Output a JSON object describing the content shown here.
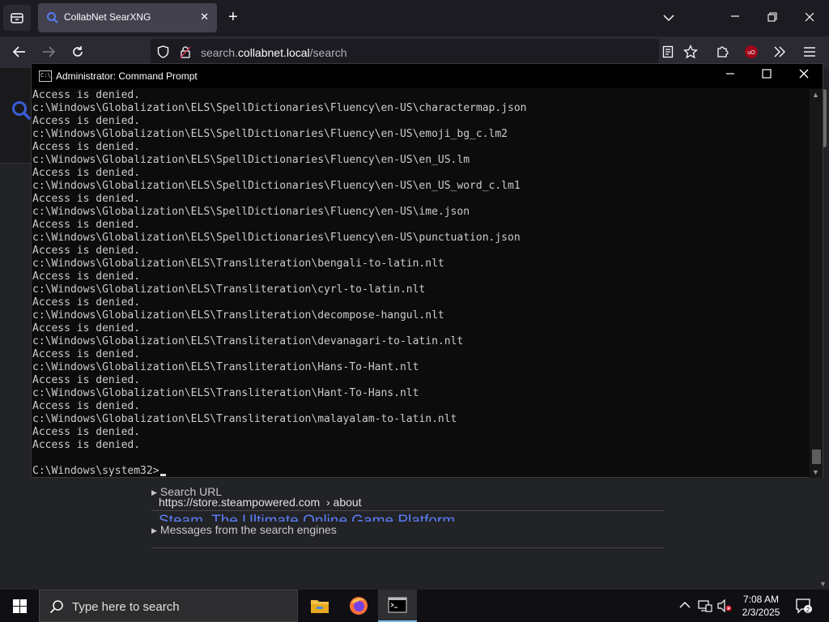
{
  "browser": {
    "tab_title": "CollabNet SearXNG",
    "tab_close_glyph": "✕",
    "new_tab_glyph": "+",
    "url_prefix": "search.",
    "url_domain": "collabnet.local",
    "url_path": "/search",
    "accent_color": "#5b7cf4"
  },
  "page": {
    "details": [
      {
        "label": "Search URL"
      },
      {
        "label": "Messages from the search engines"
      }
    ],
    "result_url": "https://store.steampowered.com",
    "result_breadcrumb": "› about",
    "result_title": "Steam, The Ultimate Online Game Platform"
  },
  "cmd": {
    "title": "Administrator: Command Prompt",
    "icon_text": "C:\\_",
    "lines": [
      "Access is denied.",
      "c:\\Windows\\Globalization\\ELS\\SpellDictionaries\\Fluency\\en-US\\charactermap.json",
      "Access is denied.",
      "c:\\Windows\\Globalization\\ELS\\SpellDictionaries\\Fluency\\en-US\\emoji_bg_c.lm2",
      "Access is denied.",
      "c:\\Windows\\Globalization\\ELS\\SpellDictionaries\\Fluency\\en-US\\en_US.lm",
      "Access is denied.",
      "c:\\Windows\\Globalization\\ELS\\SpellDictionaries\\Fluency\\en-US\\en_US_word_c.lm1",
      "Access is denied.",
      "c:\\Windows\\Globalization\\ELS\\SpellDictionaries\\Fluency\\en-US\\ime.json",
      "Access is denied.",
      "c:\\Windows\\Globalization\\ELS\\SpellDictionaries\\Fluency\\en-US\\punctuation.json",
      "Access is denied.",
      "c:\\Windows\\Globalization\\ELS\\Transliteration\\bengali-to-latin.nlt",
      "Access is denied.",
      "c:\\Windows\\Globalization\\ELS\\Transliteration\\cyrl-to-latin.nlt",
      "Access is denied.",
      "c:\\Windows\\Globalization\\ELS\\Transliteration\\decompose-hangul.nlt",
      "Access is denied.",
      "c:\\Windows\\Globalization\\ELS\\Transliteration\\devanagari-to-latin.nlt",
      "Access is denied.",
      "c:\\Windows\\Globalization\\ELS\\Transliteration\\Hans-To-Hant.nlt",
      "Access is denied.",
      "c:\\Windows\\Globalization\\ELS\\Transliteration\\Hant-To-Hans.nlt",
      "Access is denied.",
      "c:\\Windows\\Globalization\\ELS\\Transliteration\\malayalam-to-latin.nlt",
      "Access is denied.",
      "Access is denied.",
      ""
    ],
    "prompt": "C:\\Windows\\system32>"
  },
  "taskbar": {
    "search_placeholder": "Type here to search",
    "time": "7:08 AM",
    "date": "2/3/2025",
    "notification_count": "2"
  }
}
